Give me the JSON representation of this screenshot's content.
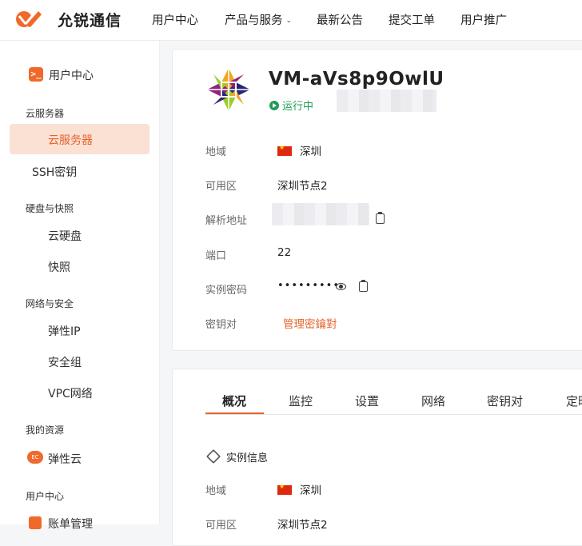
{
  "brand": {
    "name": "允锐通信"
  },
  "nav": [
    {
      "label": "用户中心"
    },
    {
      "label": "产品与服务",
      "has_dropdown": true
    },
    {
      "label": "最新公告"
    },
    {
      "label": "提交工单"
    },
    {
      "label": "用户推广"
    }
  ],
  "sidebar": {
    "top": "用户中心",
    "groups": [
      {
        "title": "云服务器",
        "items": [
          "云服务器",
          "SSH密钥"
        ]
      },
      {
        "title": "硬盘与快照",
        "items": [
          "云硬盘",
          "快照"
        ]
      },
      {
        "title": "网络与安全",
        "items": [
          "弹性IP",
          "安全组",
          "VPC网络"
        ]
      },
      {
        "title": "我的资源",
        "items": [
          "弹性云"
        ]
      },
      {
        "title": "用户中心",
        "items": [
          "账单管理"
        ]
      }
    ],
    "ec_badge": "EC",
    "active_item": "云服务器"
  },
  "instance": {
    "name": "VM-aVs8p9OwlU",
    "status": "运行中",
    "fields": {
      "region_label": "地域",
      "region_value": "深圳",
      "zone_label": "可用区",
      "zone_value": "深圳节点2",
      "address_label": "解析地址",
      "port_label": "端口",
      "port_value": "22",
      "password_label": "实例密码",
      "password_value": "•••••••••",
      "keypair_label": "密钥对",
      "keypair_value": "管理密鑰對"
    }
  },
  "tabs": [
    {
      "label": "概况",
      "active": true
    },
    {
      "label": "监控"
    },
    {
      "label": "设置"
    },
    {
      "label": "网络"
    },
    {
      "label": "密钥对"
    },
    {
      "label": "定时"
    }
  ],
  "overview": {
    "section_title": "实例信息",
    "region_label": "地域",
    "region_value": "深圳",
    "zone_label": "可用区",
    "zone_value": "深圳节点2"
  },
  "colors": {
    "accent": "#e5632a",
    "status_green": "#1f9d55",
    "active_bg": "#fbe0d4"
  }
}
